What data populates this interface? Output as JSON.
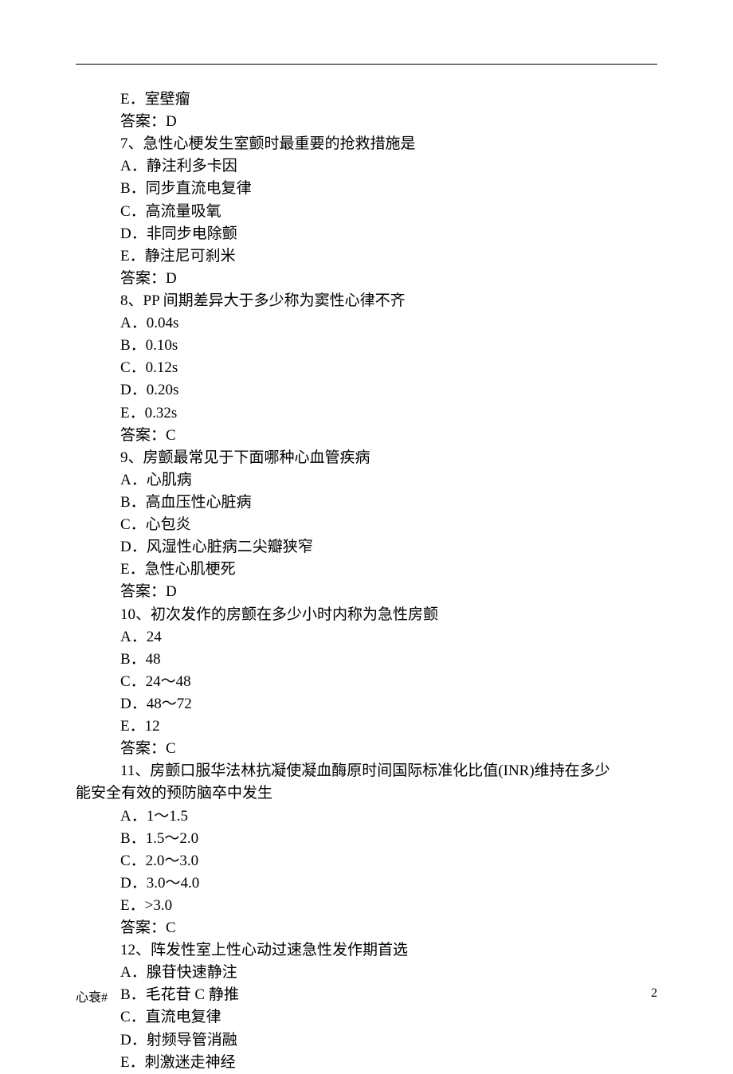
{
  "header_divider": "_________________________________________________________________",
  "lines": [
    {
      "cls": "indent1",
      "text": "E．室壁瘤"
    },
    {
      "cls": "indent1",
      "text": "答案：D"
    },
    {
      "cls": "indent1",
      "text": "7、急性心梗发生室颤时最重要的抢救措施是"
    },
    {
      "cls": "indent1",
      "text": "A．静注利多卡因"
    },
    {
      "cls": "indent1",
      "text": "B．同步直流电复律"
    },
    {
      "cls": "indent1",
      "text": "C．高流量吸氧"
    },
    {
      "cls": "indent1",
      "text": "D．非同步电除颤"
    },
    {
      "cls": "indent1",
      "text": "E．静注尼可刹米"
    },
    {
      "cls": "indent1",
      "text": "答案：D"
    },
    {
      "cls": "indent1",
      "text": "8、PP 间期差异大于多少称为窦性心律不齐"
    },
    {
      "cls": "indent1",
      "text": "A．0.04s"
    },
    {
      "cls": "indent1",
      "text": "B．0.10s"
    },
    {
      "cls": "indent1",
      "text": "C．0.12s"
    },
    {
      "cls": "indent1",
      "text": "D．0.20s"
    },
    {
      "cls": "indent1",
      "text": "E．0.32s"
    },
    {
      "cls": "indent1",
      "text": "答案：C"
    },
    {
      "cls": "indent1",
      "text": "9、房颤最常见于下面哪种心血管疾病"
    },
    {
      "cls": "indent1",
      "text": "A．心肌病"
    },
    {
      "cls": "indent1",
      "text": "B．高血压性心脏病"
    },
    {
      "cls": "indent1",
      "text": "C．心包炎"
    },
    {
      "cls": "indent1",
      "text": "D．风湿性心脏病二尖瓣狭窄"
    },
    {
      "cls": "indent1",
      "text": "E．急性心肌梗死"
    },
    {
      "cls": "indent1",
      "text": "答案：D"
    },
    {
      "cls": "indent1",
      "text": "10、初次发作的房颤在多少小时内称为急性房颤"
    },
    {
      "cls": "indent1",
      "text": "A．24"
    },
    {
      "cls": "indent1",
      "text": "B．48"
    },
    {
      "cls": "indent1",
      "text": "C．24～48"
    },
    {
      "cls": "indent1",
      "text": "D．48～72"
    },
    {
      "cls": "indent1",
      "text": "E．12"
    },
    {
      "cls": "indent1",
      "text": "答案：C"
    },
    {
      "cls": "q-stem-wrap",
      "text": "11、房颤口服华法林抗凝使凝血酶原时间国际标准化比值(INR)维持在多少"
    },
    {
      "cls": "q-stem-cont",
      "text": "能安全有效的预防脑卒中发生"
    },
    {
      "cls": "indent1",
      "text": "A．1～1.5"
    },
    {
      "cls": "indent1",
      "text": "B．1.5～2.0"
    },
    {
      "cls": "indent1",
      "text": "C．2.0～3.0"
    },
    {
      "cls": "indent1",
      "text": "D．3.0～4.0"
    },
    {
      "cls": "indent1",
      "text": "E．>3.0"
    },
    {
      "cls": "indent1",
      "text": "答案：C"
    },
    {
      "cls": "indent1",
      "text": "12、阵发性室上性心动过速急性发作期首选"
    },
    {
      "cls": "indent1",
      "text": "A．腺苷快速静注"
    },
    {
      "cls": "indent1",
      "text": "B．毛花苷 C 静推"
    },
    {
      "cls": "indent1",
      "text": "C．直流电复律"
    },
    {
      "cls": "indent1",
      "text": "D．射频导管消融"
    },
    {
      "cls": "indent1",
      "text": "E．刺激迷走神经"
    }
  ],
  "footer": {
    "left": "心衰#",
    "right": "2"
  }
}
